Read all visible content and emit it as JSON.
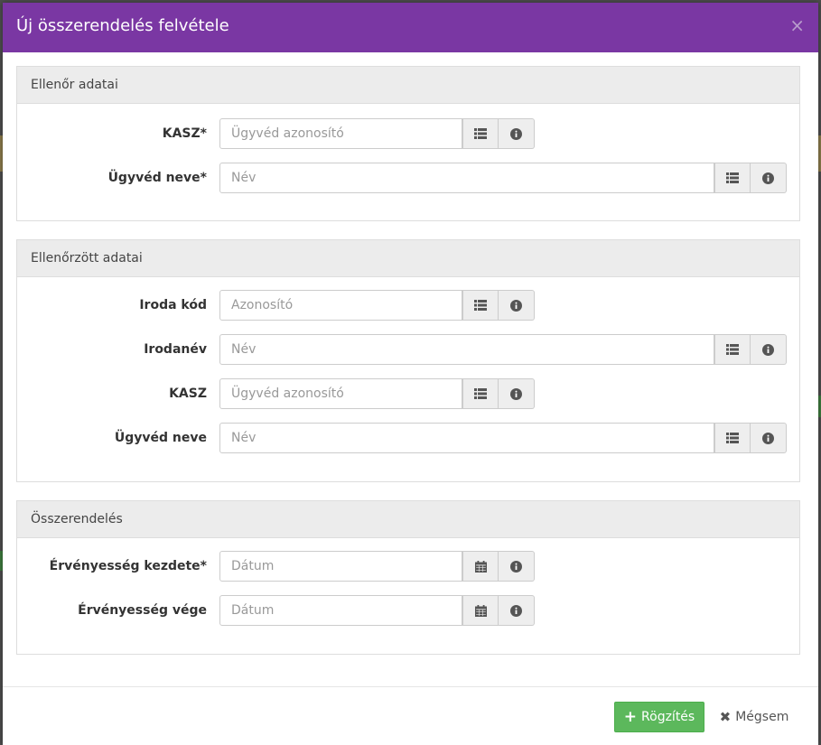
{
  "modal": {
    "title": "Új összerendelés felvétele",
    "close_symbol": "×"
  },
  "sections": [
    {
      "heading": "Ellenőr adatai",
      "fields": [
        {
          "label": "KASZ*",
          "placeholder": "Ügyvéd azonosító",
          "icon": "list-icon"
        },
        {
          "label": "Ügyvéd neve*",
          "placeholder": "Név",
          "icon": "list-icon"
        }
      ]
    },
    {
      "heading": "Ellenőrzött adatai",
      "fields": [
        {
          "label": "Iroda kód",
          "placeholder": "Azonosító",
          "icon": "list-icon"
        },
        {
          "label": "Irodanév",
          "placeholder": "Név",
          "icon": "list-icon"
        },
        {
          "label": "KASZ",
          "placeholder": "Ügyvéd azonosító",
          "icon": "list-icon"
        },
        {
          "label": "Ügyvéd neve",
          "placeholder": "Név",
          "icon": "list-icon"
        }
      ]
    },
    {
      "heading": "Összerendelés",
      "fields": [
        {
          "label": "Érvényesség kezdete*",
          "placeholder": "Dátum",
          "icon": "calendar-icon"
        },
        {
          "label": "Érvényesség vége",
          "placeholder": "Dátum",
          "icon": "calendar-icon"
        }
      ]
    }
  ],
  "footer": {
    "save_label": "Rögzítés",
    "cancel_label": "Mégsem"
  },
  "colors": {
    "header": "#7a37a3",
    "save": "#5cb85c"
  }
}
